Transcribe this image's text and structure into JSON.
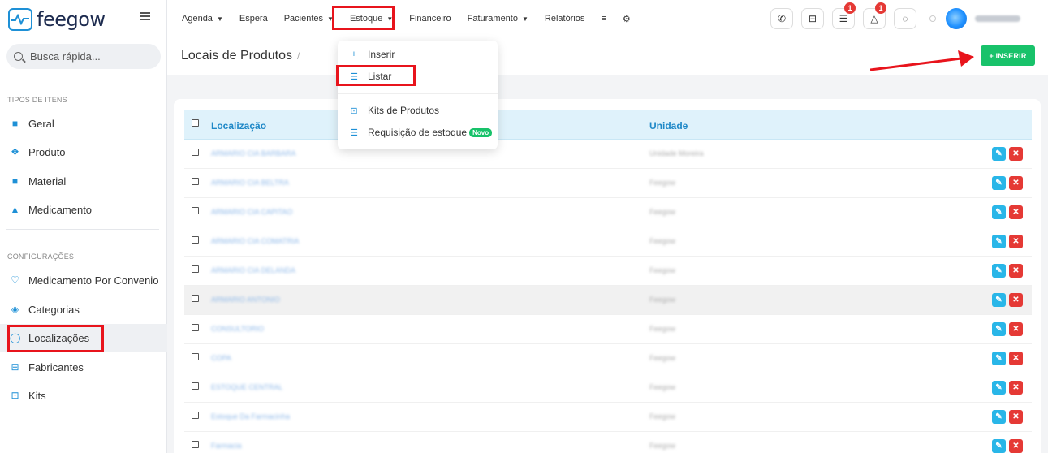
{
  "app": {
    "logo_text": "feegow"
  },
  "search": {
    "placeholder": "Busca rápida..."
  },
  "sidebar": {
    "section_types": "TIPOS DE ITENS",
    "types": [
      {
        "label": "Geral",
        "icon": "briefcase-icon"
      },
      {
        "label": "Produto",
        "icon": "cubes-icon"
      },
      {
        "label": "Material",
        "icon": "suitcase-icon"
      },
      {
        "label": "Medicamento",
        "icon": "flask-icon"
      }
    ],
    "section_config": "CONFIGURAÇÕES",
    "config": [
      {
        "label": "Medicamento Por Convenio",
        "icon": "heartbeat-icon"
      },
      {
        "label": "Categorias",
        "icon": "shapes-icon"
      },
      {
        "label": "Localizações",
        "icon": "map-pin-icon"
      },
      {
        "label": "Fabricantes",
        "icon": "sitemap-icon"
      },
      {
        "label": "Kits",
        "icon": "medkit-icon"
      }
    ],
    "active": "Localizações"
  },
  "nav": {
    "items": [
      "Agenda",
      "Espera",
      "Pacientes",
      "Estoque",
      "Financeiro",
      "Faturamento",
      "Relatórios"
    ],
    "active": "Estoque"
  },
  "topbar": {
    "badges": {
      "tasks": "1",
      "notifications": "1"
    },
    "user_name": "ANNA KARIN"
  },
  "dropdown": {
    "items": [
      {
        "label": "Inserir",
        "icon": "plus-icon"
      },
      {
        "label": "Listar",
        "icon": "list-icon"
      },
      {
        "label": "Kits de Produtos",
        "icon": "medkit-icon"
      },
      {
        "label": "Requisição de estoque",
        "icon": "checklist-icon",
        "badge": "Novo"
      }
    ]
  },
  "page": {
    "title": "Locais de Produtos",
    "separator": "/",
    "insert_label": "+ INSERIR"
  },
  "table": {
    "columns": [
      "Localização",
      "Unidade"
    ],
    "rows": [
      {
        "loc": "ARMARIO CIA BARBARA",
        "unit": "Unidade Moreira"
      },
      {
        "loc": "ARMARIO CIA BELTRA",
        "unit": "Feegow"
      },
      {
        "loc": "ARMARIO CIA CAPITAO",
        "unit": "Feegow"
      },
      {
        "loc": "ARMARIO CIA COMATRIA",
        "unit": "Feegow"
      },
      {
        "loc": "ARMARIO CIA DELANDA",
        "unit": "Feegow"
      },
      {
        "loc": "ARMARIO ANTONIO",
        "unit": "Feegow"
      },
      {
        "loc": "CONSULTORIO",
        "unit": "Feegow"
      },
      {
        "loc": "COPA",
        "unit": "Feegow"
      },
      {
        "loc": "ESTOQUE CENTRAL",
        "unit": "Feegow"
      },
      {
        "loc": "Estoque Da Farmacinha",
        "unit": "Feegow"
      },
      {
        "loc": "Farmacia",
        "unit": "Feegow"
      }
    ]
  }
}
